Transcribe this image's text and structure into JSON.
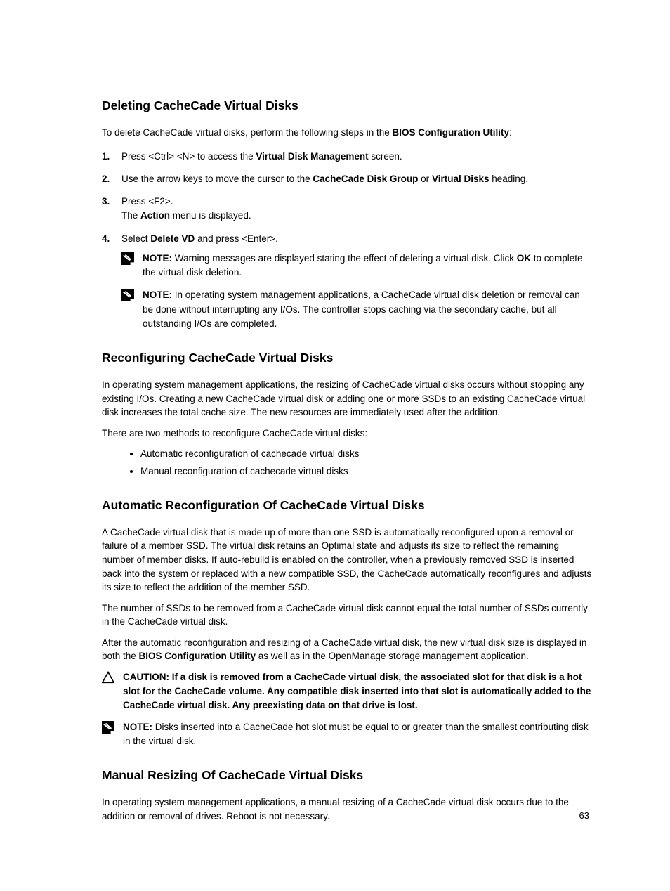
{
  "sections": {
    "deleting": {
      "title": "Deleting CacheCade Virtual Disks",
      "intro_pre": "To delete CacheCade virtual disks, perform the following steps in the ",
      "intro_bold": "BIOS Configuration Utility",
      "intro_post": ":",
      "steps": {
        "s1": {
          "pre": "Press <Ctrl> <N> to access the ",
          "bold": "Virtual Disk Management",
          "post": " screen."
        },
        "s2": {
          "pre": "Use the arrow keys to move the cursor to the ",
          "bold1": "CacheCade Disk Group",
          "mid": " or ",
          "bold2": "Virtual Disks",
          "post": " heading."
        },
        "s3": {
          "line1": "Press <F2>.",
          "line2_pre": "The ",
          "line2_bold": "Action",
          "line2_post": " menu is displayed."
        },
        "s4": {
          "pre": "Select ",
          "bold": "Delete VD",
          "post": " and press <Enter>."
        }
      },
      "note1": {
        "label": "NOTE:",
        "pre": " Warning messages are displayed stating the effect of deleting a virtual disk. Click ",
        "bold": "OK",
        "post": " to complete the virtual disk deletion."
      },
      "note2": {
        "label": "NOTE:",
        "text": " In operating system management applications, a CacheCade virtual disk deletion or removal can be done without interrupting any I/Os. The controller stops caching via the secondary cache, but all outstanding I/Os are completed."
      }
    },
    "reconfig": {
      "title": "Reconfiguring CacheCade Virtual Disks",
      "p1": "In operating system management applications, the resizing of CacheCade virtual disks occurs without stopping any existing I/Os. Creating a new CacheCade virtual disk or adding one or more SSDs to an existing CacheCade virtual disk increases the total cache size. The new resources are immediately used after the addition.",
      "p2": "There are two methods to reconfigure CacheCade virtual disks:",
      "b1": "Automatic reconfiguration of cachecade virtual disks",
      "b2": "Manual reconfiguration of cachecade virtual disks"
    },
    "auto": {
      "title": "Automatic Reconfiguration Of CacheCade Virtual Disks",
      "p1": "A CacheCade virtual disk that is made up of more than one SSD is automatically reconfigured upon a removal or failure of a member SSD. The virtual disk retains an Optimal state and adjusts its size to reflect the remaining number of member disks. If auto-rebuild is enabled on the controller, when a previously removed SSD is inserted back into the system or replaced with a new compatible SSD, the CacheCade automatically reconfigures and adjusts its size to reflect the addition of the member SSD.",
      "p2": "The number of SSDs to be removed from a CacheCade virtual disk cannot equal the total number of SSDs currently in the CacheCade virtual disk.",
      "p3_pre": "After the automatic reconfiguration and resizing of a CacheCade virtual disk, the new virtual disk size is displayed in both the ",
      "p3_bold": "BIOS Configuration Utility",
      "p3_post": " as well as in the OpenManage storage management application.",
      "caution": {
        "label": "CAUTION: ",
        "text": "If a disk is removed from a CacheCade virtual disk, the associated slot for that disk is a hot slot for the CacheCade volume. Any compatible disk inserted into that slot is automatically added to the CacheCade virtual disk. Any preexisting data on that drive is lost."
      },
      "note": {
        "label": "NOTE:",
        "text": " Disks inserted into a CacheCade hot slot must be equal to or greater than the smallest contributing disk in the virtual disk."
      }
    },
    "manual": {
      "title": "Manual Resizing Of CacheCade Virtual Disks",
      "p1": "In operating system management applications, a manual resizing of a CacheCade virtual disk occurs due to the addition or removal of drives. Reboot is not necessary."
    }
  },
  "pageNumber": "63"
}
